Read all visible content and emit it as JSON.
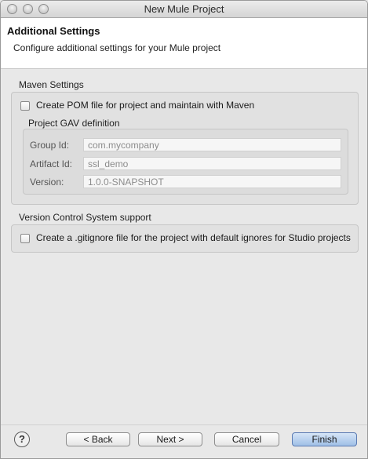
{
  "window": {
    "title": "New Mule Project"
  },
  "header": {
    "title": "Additional Settings",
    "subtitle": "Configure additional settings for your Mule project"
  },
  "maven": {
    "section_label": "Maven Settings",
    "create_pom_label": "Create POM file for project and maintain with Maven",
    "create_pom_checked": false,
    "gav": {
      "label": "Project GAV definition",
      "group_id_label": "Group Id:",
      "group_id_value": "com.mycompany",
      "artifact_id_label": "Artifact Id:",
      "artifact_id_value": "ssl_demo",
      "version_label": "Version:",
      "version_value": "1.0.0-SNAPSHOT"
    }
  },
  "vcs": {
    "section_label": "Version Control System support",
    "gitignore_label": "Create a .gitignore file for the project with default ignores for Studio projects",
    "gitignore_checked": false
  },
  "buttons": {
    "help": "?",
    "back": "< Back",
    "next": "Next >",
    "cancel": "Cancel",
    "finish": "Finish"
  }
}
